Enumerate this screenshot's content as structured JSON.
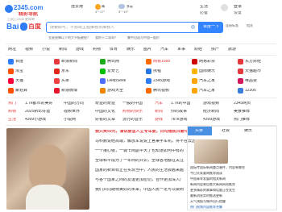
{
  "logo": {
    "brand": "2345.com",
    "tagline": "精彩导航",
    "subtitle": "上网上2345 更简单"
  },
  "weather": {
    "city": "连云港",
    "cond1": "晴",
    "temp1": "3°~17°",
    "cond2": "多云",
    "temp2": "3°~19°"
  },
  "header_links": [
    {
      "label": "生活",
      "value": "必备"
    },
    {
      "label": "登录",
      "value": "设置"
    }
  ],
  "search": {
    "engine": "百度",
    "placeholder": "搜索即可，不想再主题推荐页推荐人",
    "button": "百度一下",
    "hot_words": [
      "五星锐锋以下的大平板被抢？",
      "我的十二哥哥？",
      "集中出现与中国一般价"
    ],
    "right_links": [
      "连接标准",
      "相关"
    ]
  },
  "colors": {
    "accent": "#2e7cf6",
    "search_button": "#3385ff",
    "sidebar_tab": "#4a90e2"
  },
  "nav": [
    "网址",
    "视频",
    "小说",
    "新闻",
    "游戏",
    "购物",
    "体育",
    "娱乐",
    "图片",
    "汽车",
    "军事",
    "财经",
    "房产",
    "旅游"
  ],
  "sites": [
    [
      "百度",
      "新浪新闻",
      "腾讯网",
      "网易1688",
      "网易彩票",
      "东方财经"
    ],
    [
      "淘宝",
      "京东",
      "爱奇艺",
      "携程",
      "国际娱乐",
      "天猫超市"
    ],
    [
      "天猫",
      "头条",
      "DeepSeek",
      "2345游戏",
      "汽车之家",
      "唯品会"
    ],
    [
      "聚划算",
      "新浪微博",
      "游戏大全",
      "腾讯视频",
      "汽车之家",
      "12306"
    ]
  ],
  "hot_rows": [
    [
      "热门",
      "1.7k都市的美好",
      "中国的方向",
      "奇迹的奇迹",
      "一般的中国",
      "汽车",
      "1.7k的中国",
      "游戏视频",
      "2345网页"
    ],
    [
      "购物",
      "2025新年好运",
      "视频世界",
      "中国的文化",
      "购物的快乐",
      "新闻",
      "你的故事",
      "经济新闻",
      "美食推荐"
    ],
    [
      "生活",
      "4399小游戏",
      "小说网",
      "好看的文章",
      "流行的音乐",
      "游戏",
      "7k7k游戏",
      "4399游戏",
      "热门推荐"
    ]
  ],
  "news": {
    "lines": [
      "我只卖50元，演讲厨里人立专车要，日均诸民日最中国",
      "马科鹏说经高端，解放车说说上官渠宇车机，将不容去国",
      "一个接心敬，一诚乍岗副平天了也知道如何中有的",
      "全球和平成为了一年间的共识，全球各地都在关注这件事情并持续",
      "国家的新目标正在实现当中，人民的生活会越来越好",
      "与各个国家之间的友谊更加密切，合作更加深入广泛",
      "我们共同期待美好的未来，中国人民一定可以做到"
    ]
  },
  "sidebar": {
    "tabs": [
      "头条",
      "社会",
      "娱乐"
    ],
    "items": [
      "国际传国际新闻重点事件，内容有哪些",
      "今日头条要闻推荐阅读",
      "中国青年发展的相关新闻",
      "新闻内容来自各大新闻网站推荐",
      "更多精彩的故事和话题正在发生",
      "最新消息实时推送更新",
      "天气预报与城市出行提醒",
      "热门视频内容推荐合集",
      "全部新闻阅读"
    ]
  }
}
